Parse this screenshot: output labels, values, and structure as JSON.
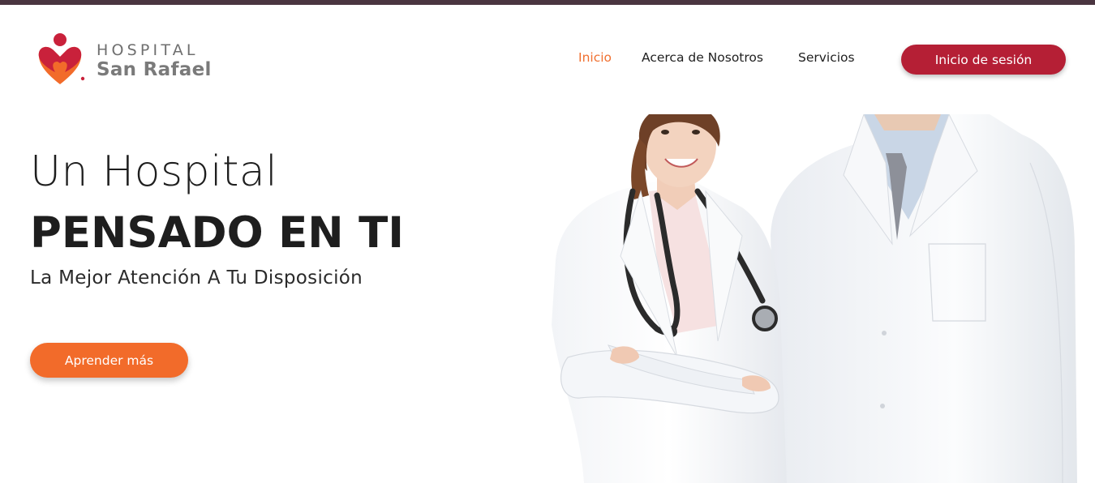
{
  "brand": {
    "line1": "HOSPITAL",
    "line2": "San Rafael",
    "colors": {
      "heart_red": "#c9213b",
      "heart_orange": "#f26b2a",
      "text_gray": "#7a7a7a"
    }
  },
  "nav": {
    "items": [
      {
        "label": "Inicio",
        "active": true
      },
      {
        "label": "Acerca de Nosotros",
        "active": false
      },
      {
        "label": "Servicios",
        "active": false
      }
    ],
    "login_label": "Inicio de sesión"
  },
  "hero": {
    "title_line1": "Un Hospital",
    "title_line2": "PENSADO EN TI",
    "subtitle": "La Mejor Atención A Tu Disposición",
    "cta_label": "Aprender más",
    "image_subject": "two doctors in white coats, female doctor with stethoscope and arms crossed, male doctor with tie"
  },
  "colors": {
    "top_bar": "#4a3540",
    "active_nav": "#f07030",
    "login_button": "#b51f35",
    "cta_button": "#f26b2a"
  }
}
